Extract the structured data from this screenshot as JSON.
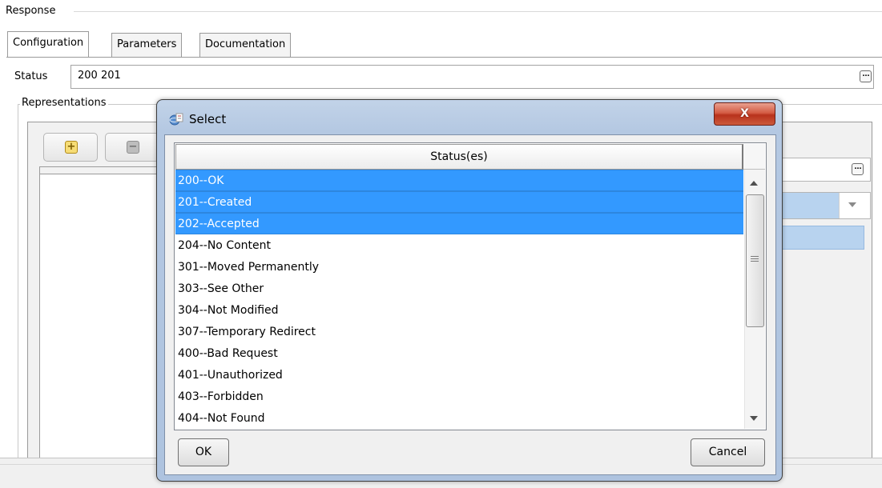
{
  "panel": {
    "title": "Response",
    "tabs": [
      {
        "label": "Configuration",
        "active": true
      },
      {
        "label": "Parameters",
        "active": false
      },
      {
        "label": "Documentation",
        "active": false
      }
    ],
    "status_label": "Status",
    "status_value": "200 201",
    "representations_label": "Representations",
    "ellipsis_glyph": "…"
  },
  "dialog": {
    "title": "Select",
    "close_glyph": "X",
    "column_header": "Status(es)",
    "rows": [
      {
        "label": "200--OK",
        "selected": true
      },
      {
        "label": "201--Created",
        "selected": true
      },
      {
        "label": "202--Accepted",
        "selected": true
      },
      {
        "label": "204--No Content",
        "selected": false
      },
      {
        "label": "301--Moved Permanently",
        "selected": false
      },
      {
        "label": "303--See Other",
        "selected": false
      },
      {
        "label": "304--Not Modified",
        "selected": false
      },
      {
        "label": "307--Temporary Redirect",
        "selected": false
      },
      {
        "label": "400--Bad Request",
        "selected": false
      },
      {
        "label": "401--Unauthorized",
        "selected": false
      },
      {
        "label": "403--Forbidden",
        "selected": false
      },
      {
        "label": "404--Not Found",
        "selected": false
      }
    ],
    "ok_label": "OK",
    "cancel_label": "Cancel"
  },
  "colors": {
    "selection": "#3399ff",
    "close_button": "#c8432a",
    "dialog_frame": "#b4c8e2"
  }
}
